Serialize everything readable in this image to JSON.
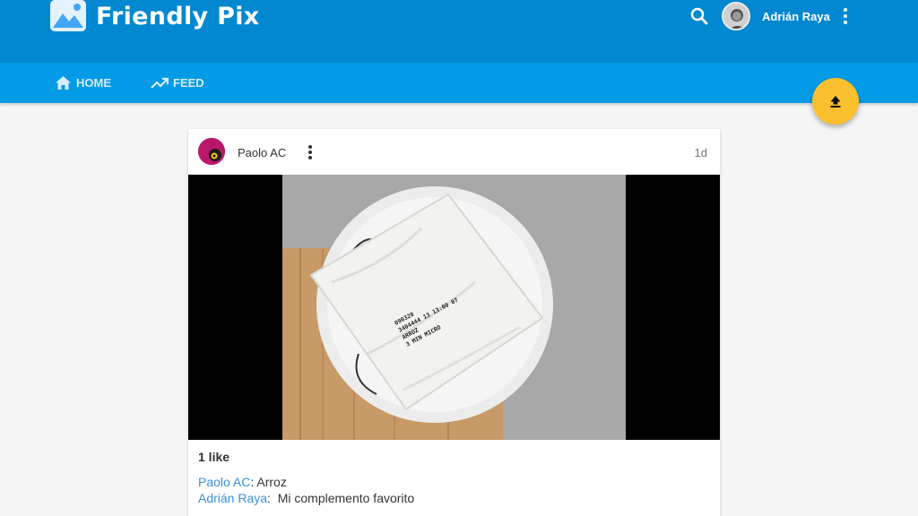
{
  "app": {
    "title": "Friendly Pix"
  },
  "header": {
    "user_name": "Adrián Raya",
    "search_icon": "search-icon",
    "more_icon": "more-vert-icon"
  },
  "nav": {
    "tabs": [
      {
        "label": "HOME",
        "icon": "home-icon"
      },
      {
        "label": "FEED",
        "icon": "trending-up-icon"
      }
    ]
  },
  "fab": {
    "icon": "upload-icon"
  },
  "post": {
    "author": "Paolo AC",
    "time": "1d",
    "likes": "1 like",
    "comments": [
      {
        "author": "Paolo AC",
        "separator": ": ",
        "text": "Arroz"
      },
      {
        "author": "Adrián Raya",
        "separator": ":  ",
        "text": "Mi complemento favorito"
      }
    ],
    "package_label": [
      "090320",
      "3404444 13 13:00 07",
      "ARROZ",
      "3 MIN MICRO"
    ]
  },
  "colors": {
    "appbar": "#0288d1",
    "subnav": "#039be5",
    "fab": "#fbc02d",
    "link": "#3b8fd6"
  }
}
